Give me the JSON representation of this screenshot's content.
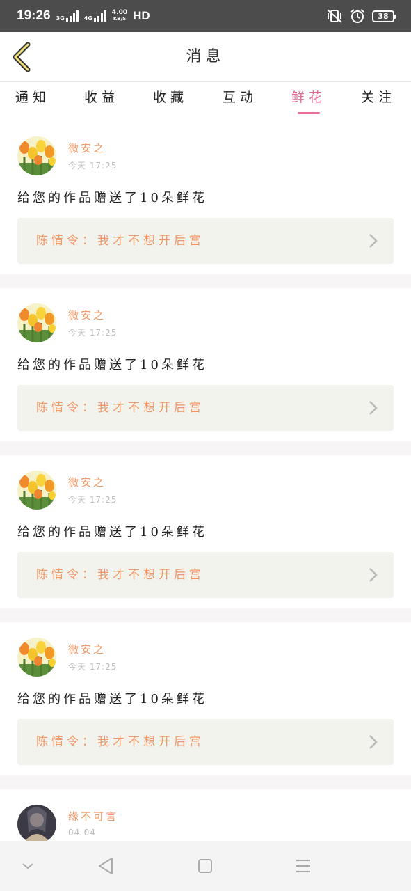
{
  "status_bar": {
    "time": "19:26",
    "network_3g": "3G",
    "network_4g": "4G",
    "speed_value": "4.00",
    "speed_unit": "KB/S",
    "hd": "HD",
    "battery": "38"
  },
  "header": {
    "title": "消息"
  },
  "tabs": [
    {
      "label": "通知"
    },
    {
      "label": "收益"
    },
    {
      "label": "收藏"
    },
    {
      "label": "互动"
    },
    {
      "label": "鲜花",
      "active": true
    },
    {
      "label": "关注"
    }
  ],
  "feed": [
    {
      "user": "微安之",
      "time": "今天 17:25",
      "message": "给您的作品赠送了10朵鲜花",
      "work": "陈情令：我才不想开后宫",
      "avatar": "tulip-avatar"
    },
    {
      "user": "微安之",
      "time": "今天 17:25",
      "message": "给您的作品赠送了10朵鲜花",
      "work": "陈情令：我才不想开后宫",
      "avatar": "tulip-avatar"
    },
    {
      "user": "微安之",
      "time": "今天 17:25",
      "message": "给您的作品赠送了10朵鲜花",
      "work": "陈情令：我才不想开后宫",
      "avatar": "tulip-avatar"
    },
    {
      "user": "微安之",
      "time": "今天 17:25",
      "message": "给您的作品赠送了10朵鲜花",
      "work": "陈情令：我才不想开后宫",
      "avatar": "tulip-avatar"
    },
    {
      "user": "缘不可言",
      "time": "04-04",
      "avatar": "portrait-avatar"
    }
  ],
  "colors": {
    "accent": "#e96d98",
    "username": "#ef9766",
    "card_bg": "#f3f3ee",
    "status_bar": "#4c4c4c"
  },
  "icons": {
    "back": "chevron-left-icon",
    "chevron": "chevron-right-icon",
    "nav": [
      "chevron-down-icon",
      "triangle-back-icon",
      "square-home-icon",
      "menu-icon"
    ]
  }
}
